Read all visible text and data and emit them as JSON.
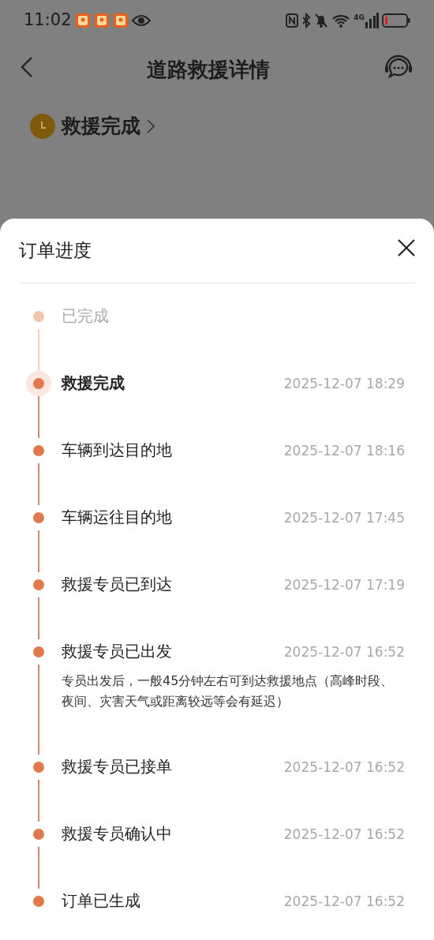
{
  "status_bar": {
    "time": "11:02",
    "network": "4G"
  },
  "nav": {
    "title": "道路救援详情"
  },
  "status": {
    "label": "救援完成"
  },
  "sheet": {
    "title": "订单进度",
    "steps": [
      {
        "kind": "done",
        "title": "已完成",
        "selected": false
      },
      {
        "kind": "step",
        "title": "救援完成",
        "time": "2025-12-07 18:29",
        "selected": true
      },
      {
        "kind": "step",
        "title": "车辆到达目的地",
        "time": "2025-12-07 18:16",
        "selected": false
      },
      {
        "kind": "step",
        "title": "车辆运往目的地",
        "time": "2025-12-07 17:45",
        "selected": false
      },
      {
        "kind": "step",
        "title": "救援专员已到达",
        "time": "2025-12-07 17:19",
        "selected": false
      },
      {
        "kind": "step",
        "title": "救援专员已出发",
        "time": "2025-12-07 16:52",
        "selected": false,
        "note": "专员出发后，一般45分钟左右可到达救援地点（高峰时段、夜间、灾害天气或距离较远等会有延迟）"
      },
      {
        "kind": "step",
        "title": "救援专员已接单",
        "time": "2025-12-07 16:52",
        "selected": false
      },
      {
        "kind": "step",
        "title": "救援专员确认中",
        "time": "2025-12-07 16:52",
        "selected": false
      },
      {
        "kind": "step",
        "title": "订单已生成",
        "time": "2025-12-07 16:52",
        "selected": false
      }
    ]
  }
}
